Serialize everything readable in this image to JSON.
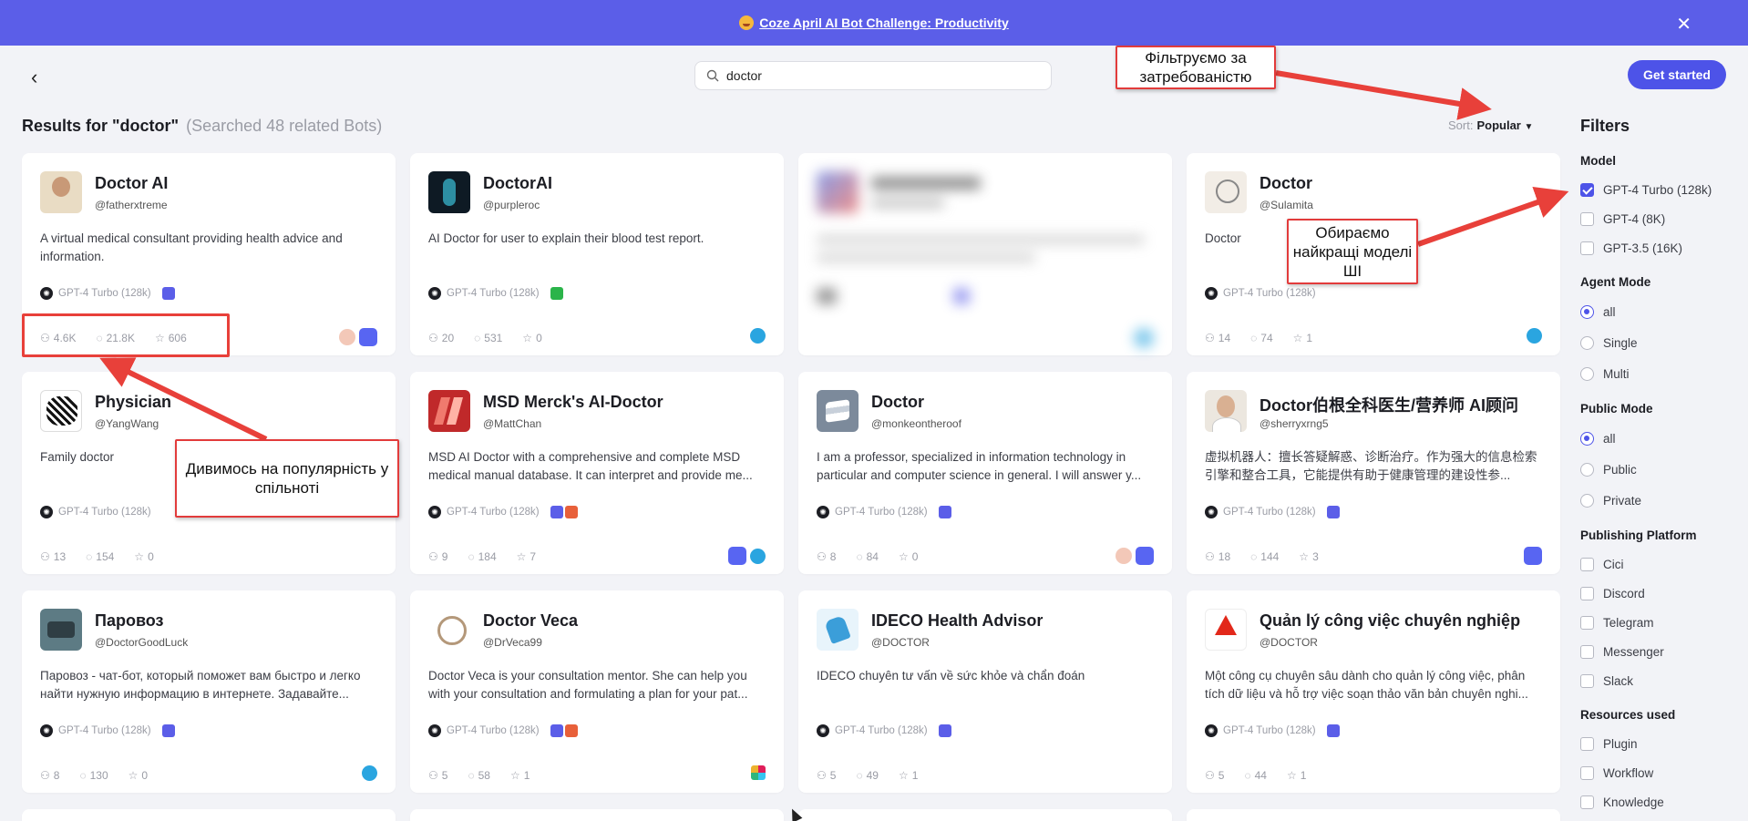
{
  "banner": {
    "text": "Coze April AI Bot Challenge: Productivity"
  },
  "search": {
    "value": "doctor"
  },
  "header": {
    "get_started": "Get started"
  },
  "results": {
    "title": "Results for \"doctor\"",
    "count_text": "(Searched 48 related Bots)"
  },
  "sort": {
    "label": "Sort:",
    "value": "Popular"
  },
  "model_name": "GPT-4 Turbo (128k)",
  "cards": [
    {
      "name": "Doctor AI",
      "handle": "@fatherxtreme",
      "desc": "A virtual medical consultant providing health advice and information.",
      "users": "4.6K",
      "chats": "21.8K",
      "stars": "606"
    },
    {
      "name": "DoctorAI",
      "handle": "@purpleroc",
      "desc": "AI Doctor for user to explain their blood test report.",
      "users": "20",
      "chats": "531",
      "stars": "0"
    },
    {
      "name": "Doctor",
      "handle": "@Sulamita",
      "desc": "Doctor",
      "users": "14",
      "chats": "74",
      "stars": "1"
    },
    {
      "name": "Physician",
      "handle": "@YangWang",
      "desc": "Family doctor",
      "users": "13",
      "chats": "154",
      "stars": "0"
    },
    {
      "name": "MSD Merck's AI-Doctor",
      "handle": "@MattChan",
      "desc": "MSD AI Doctor with a comprehensive and complete MSD medical manual database. It can interpret and provide me...",
      "users": "9",
      "chats": "184",
      "stars": "7"
    },
    {
      "name": "Doctor",
      "handle": "@monkeontheroof",
      "desc": "I am a professor, specialized in information technology in particular and computer science in general. I will answer y...",
      "users": "8",
      "chats": "84",
      "stars": "0"
    },
    {
      "name": "Doctor伯根全科医生/营养师 AI顾问",
      "handle": "@sherryxrng5",
      "desc": "虚拟机器人：擅长答疑解惑、诊断治疗。作为强大的信息检索引擎和整合工具，它能提供有助于健康管理的建设性参...",
      "users": "18",
      "chats": "144",
      "stars": "3"
    },
    {
      "name": "Паровоз",
      "handle": "@DoctorGoodLuck",
      "desc": "Паровоз - чат-бот, который поможет вам быстро и легко найти нужную информацию в интернете. Задавайте...",
      "users": "8",
      "chats": "130",
      "stars": "0"
    },
    {
      "name": "Doctor Veca",
      "handle": "@DrVeca99",
      "desc": "Doctor Veca is your consultation mentor. She can help you with your consultation and formulating a plan for your pat...",
      "users": "5",
      "chats": "58",
      "stars": "1"
    },
    {
      "name": "IDECO Health Advisor",
      "handle": "@DOCTOR",
      "desc": "IDECO chuyên tư vấn về sức khỏe và chẩn đoán",
      "users": "5",
      "chats": "49",
      "stars": "1"
    },
    {
      "name": "Quản lý công việc chuyên nghiệp",
      "handle": "@DOCTOR",
      "desc": "Một công cụ chuyên sâu dành cho quản lý công việc, phân tích dữ liệu và hỗ trợ việc soạn thảo văn bản chuyên nghi...",
      "users": "5",
      "chats": "44",
      "stars": "1"
    }
  ],
  "filters": {
    "title": "Filters",
    "model": {
      "title": "Model",
      "options": [
        "GPT-4 Turbo (128k)",
        "GPT-4 (8K)",
        "GPT-3.5 (16K)"
      ],
      "checked": [
        true,
        false,
        false
      ]
    },
    "agent_mode": {
      "title": "Agent Mode",
      "options": [
        "all",
        "Single",
        "Multi"
      ],
      "selected": "all"
    },
    "public_mode": {
      "title": "Public Mode",
      "options": [
        "all",
        "Public",
        "Private"
      ],
      "selected": "all"
    },
    "platform": {
      "title": "Publishing Platform",
      "options": [
        "Cici",
        "Discord",
        "Telegram",
        "Messenger",
        "Slack"
      ]
    },
    "resources": {
      "title": "Resources used",
      "options": [
        "Plugin",
        "Workflow",
        "Knowledge"
      ]
    }
  },
  "annotations": {
    "sort_note": "Фільтруємо за затребованістю",
    "model_note": "Обираємо найкращі моделі ШІ",
    "popularity_note": "Дивимось на популярність у спільноті"
  },
  "colors": {
    "accent": "#4d53e8",
    "banner": "#5b5ee8",
    "annotation": "#e8403a"
  }
}
